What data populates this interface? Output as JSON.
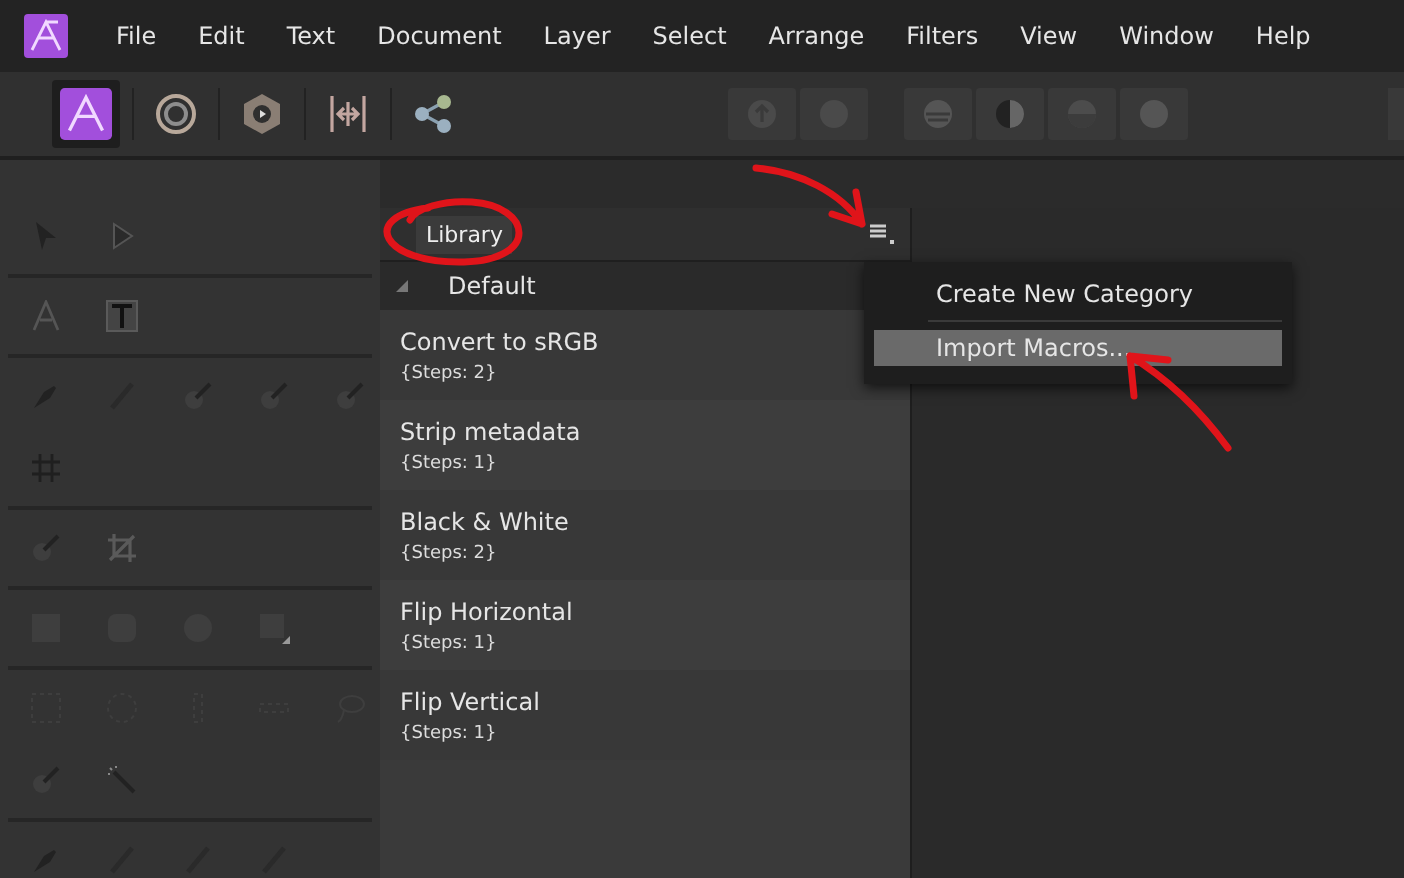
{
  "menu_bar": {
    "items": [
      "File",
      "Edit",
      "Text",
      "Document",
      "Layer",
      "Select",
      "Arrange",
      "Filters",
      "View",
      "Window",
      "Help"
    ]
  },
  "library_panel": {
    "tab": "Library",
    "category": {
      "label": "Default",
      "expanded": true
    },
    "macros": [
      {
        "name": "Convert to sRGB",
        "steps": "{Steps: 2}"
      },
      {
        "name": "Strip metadata",
        "steps": "{Steps: 1}"
      },
      {
        "name": "Black & White",
        "steps": "{Steps: 2}"
      },
      {
        "name": "Flip Horizontal",
        "steps": "{Steps: 1}"
      },
      {
        "name": "Flip Vertical",
        "steps": "{Steps: 1}"
      }
    ]
  },
  "panel_menu": {
    "items": [
      {
        "label": "Create New Category",
        "selected": false
      },
      {
        "label": "Import Macros...",
        "selected": true
      }
    ]
  }
}
